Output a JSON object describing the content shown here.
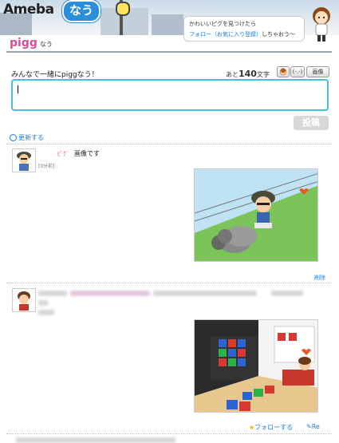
{
  "header": {
    "logo_text": "Ameba",
    "logo_badge": "なう",
    "bubble_line1": "かわいいピグを見つけたら",
    "bubble_link": "フォロー（お気に入り登録）",
    "bubble_suffix": "しちゃおう～"
  },
  "channel": {
    "name": "pigg",
    "suffix": "なう"
  },
  "composer": {
    "prompt": "みんなで一緒にpiggなう！",
    "count_prefix": "あと",
    "count_value": "140",
    "count_suffix": "文字",
    "tool_image": "画像",
    "tool_emoticon": "(-.-)",
    "post_label": "投稿"
  },
  "refresh_label": "更新する",
  "posts": [
    {
      "user": "ﾋﾟｸﾞ",
      "text": "画像です",
      "time": "[0分前]",
      "delete_label": "削除"
    }
  ],
  "footer": {
    "follow_label": "フォローする",
    "reply_label": "Re"
  },
  "colors": {
    "accent": "#2a8fd8",
    "pigg_pink": "#e04a9c",
    "input_border": "#46c3d3"
  }
}
